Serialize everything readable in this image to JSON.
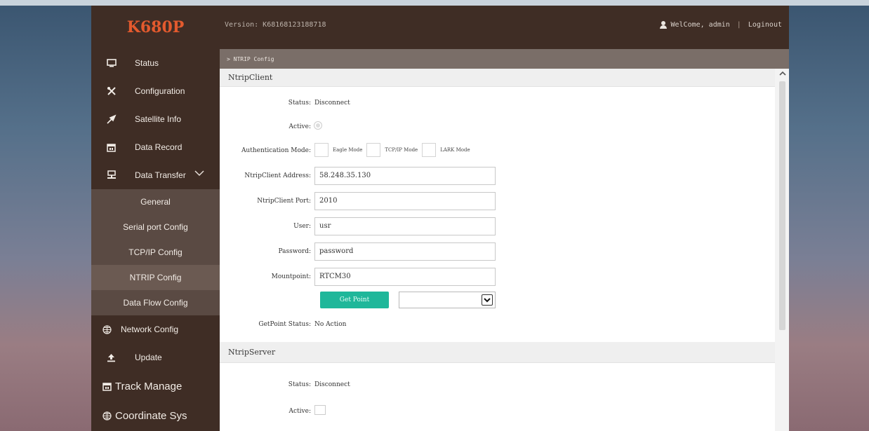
{
  "header": {
    "logo": "K680P",
    "version": "Version: K68168123188718",
    "welcome": "WelCome, admin",
    "separator": "|",
    "logout": "Loginout"
  },
  "sidebar": {
    "items": [
      {
        "label": "Status",
        "icon": "monitor-icon"
      },
      {
        "label": "Configuration",
        "icon": "tools-icon"
      },
      {
        "label": "Satellite Info",
        "icon": "satellite-icon"
      },
      {
        "label": "Data Record",
        "icon": "calendar-icon"
      },
      {
        "label": "Data Transfer",
        "icon": "network-icon"
      }
    ],
    "subitems": [
      "General",
      "Serial port Config",
      "TCP/IP Config",
      "NTRIP Config",
      "Data Flow Config"
    ],
    "items_after": [
      {
        "label": "Network Config",
        "icon": "globe-icon"
      },
      {
        "label": "Update",
        "icon": "upload-icon"
      },
      {
        "label": "Track Manage",
        "icon": "calendar-icon"
      },
      {
        "label": "Coordinate Sys",
        "icon": "globe-icon"
      }
    ]
  },
  "breadcrumb": "> NTRIP Config",
  "ntrip_client": {
    "title": "NtripClient",
    "status_label": "Status:",
    "status_value": "Disconnect",
    "active_label": "Active:",
    "auth_label": "Authentication Mode:",
    "auth_options": [
      "Eagle Mode",
      "TCP/IP Mode",
      "LARK Mode"
    ],
    "address_label": "NtripClient Address:",
    "address_value": "58.248.35.130",
    "port_label": "NtripClient Port:",
    "port_value": "2010",
    "user_label": "User:",
    "user_value": "usr",
    "password_label": "Password:",
    "password_value": "password",
    "mountpoint_label": "Mountpoint:",
    "mountpoint_value": "RTCM30",
    "get_point_button": "Get Point",
    "getpoint_status_label": "GetPoint Status:",
    "getpoint_status_value": "No Action"
  },
  "ntrip_server": {
    "title": "NtripServer",
    "status_label": "Status:",
    "status_value": "Disconnect",
    "active_label": "Active:"
  },
  "colors": {
    "header_bg": "#3f2d25",
    "logo": "#e35a2e",
    "accent_button": "#1fb79a"
  }
}
